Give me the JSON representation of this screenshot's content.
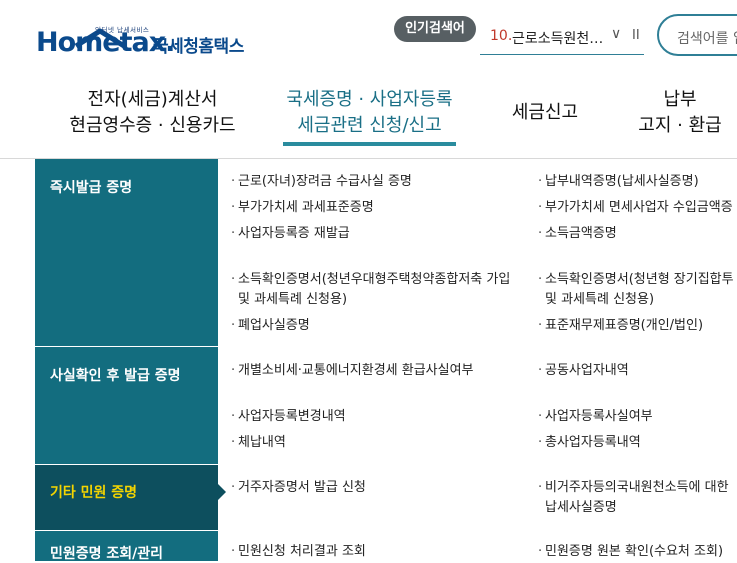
{
  "header": {
    "logo_tagline": "인터넷 납세서비스",
    "logo_word": "Hometax.",
    "logo_kr": "국세청홈택스",
    "popular_badge": "인기검색어",
    "popular_rank": "10.",
    "popular_term": "근로소득원천징수",
    "search_placeholder": "검색어를 입"
  },
  "nav": {
    "item1_line1": "전자(세금)계산서",
    "item1_line2": "현금영수증 · 신용카드",
    "item2_line1": "국세증명 · 사업자등록",
    "item2_line2": "세금관련 신청/신고",
    "item3": "세금신고",
    "item4_line1": "납부",
    "item4_line2": "고지 · 환급"
  },
  "categories": {
    "c1": "즉시발급 증명",
    "c2": "사실확인 후 발급 증명",
    "c3": "기타 민원 증명",
    "c4": "민원증명 조회/관리"
  },
  "items": {
    "a1": "근로(자녀)장려금 수급사실 증명",
    "a2": "부가가치세 과세표준증명",
    "a3": "사업자등록증 재발급",
    "a4_1": "소득확인증명서(청년우대형주택청약종합저축 가입",
    "a4_2": "및 과세특례 신청용)",
    "a5": "폐업사실증명",
    "b1": "납부내역증명(납세사실증명)",
    "b2": "부가가치세 면세사업자 수입금액증",
    "b3": "소득금액증명",
    "b4_1": "소득확인증명서(청년형 장기집합투",
    "b4_2": "및 과세특례 신청용)",
    "b5": "표준재무제표증명(개인/법인)",
    "a6": "개별소비세·교통에너지환경세 환급사실여부",
    "a7": "사업자등록변경내역",
    "a8": "체납내역",
    "b6": "공동사업자내역",
    "b7": "사업자등록사실여부",
    "b8": "총사업자등록내역",
    "a9": "거주자증명서 발급 신청",
    "b9_1": "비거주자등의국내원천소득에 대한",
    "b9_2": "납세사실증명",
    "a10": "민원신청 처리결과 조회",
    "b10": "민원증명 원본 확인(수요처 조회)"
  }
}
